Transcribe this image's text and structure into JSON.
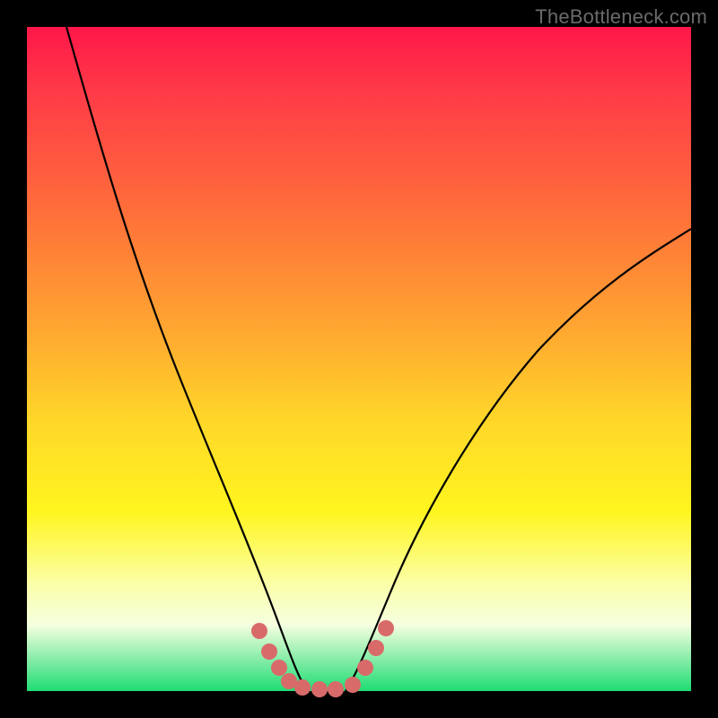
{
  "watermark": "TheBottleneck.com",
  "chart_data": {
    "type": "line",
    "title": "",
    "xlabel": "",
    "ylabel": "",
    "xlim": [
      0,
      100
    ],
    "ylim": [
      0,
      100
    ],
    "background_gradient": [
      "#ff1749",
      "#ff6f3a",
      "#ffd928",
      "#fbffa9",
      "#1fdc74"
    ],
    "series": [
      {
        "name": "left-curve",
        "x": [
          6,
          10,
          15,
          20,
          25,
          30,
          33,
          36,
          38,
          40,
          42
        ],
        "y": [
          100,
          84,
          66,
          49,
          34,
          20,
          13,
          7,
          3,
          1,
          0
        ]
      },
      {
        "name": "right-curve",
        "x": [
          48,
          50,
          53,
          57,
          62,
          70,
          80,
          90,
          100
        ],
        "y": [
          0,
          2,
          7,
          15,
          25,
          39,
          53,
          63,
          70
        ]
      }
    ],
    "markers": {
      "name": "bottleneck-markers",
      "color": "#d96a6a",
      "points": [
        {
          "x": 35.0,
          "y": 9.0
        },
        {
          "x": 36.5,
          "y": 6.0
        },
        {
          "x": 38.0,
          "y": 3.5
        },
        {
          "x": 39.5,
          "y": 1.5
        },
        {
          "x": 41.5,
          "y": 0.5
        },
        {
          "x": 44.0,
          "y": 0.3
        },
        {
          "x": 46.5,
          "y": 0.3
        },
        {
          "x": 49.0,
          "y": 1.0
        },
        {
          "x": 51.0,
          "y": 3.5
        },
        {
          "x": 52.5,
          "y": 6.5
        },
        {
          "x": 54.0,
          "y": 9.5
        }
      ]
    }
  }
}
